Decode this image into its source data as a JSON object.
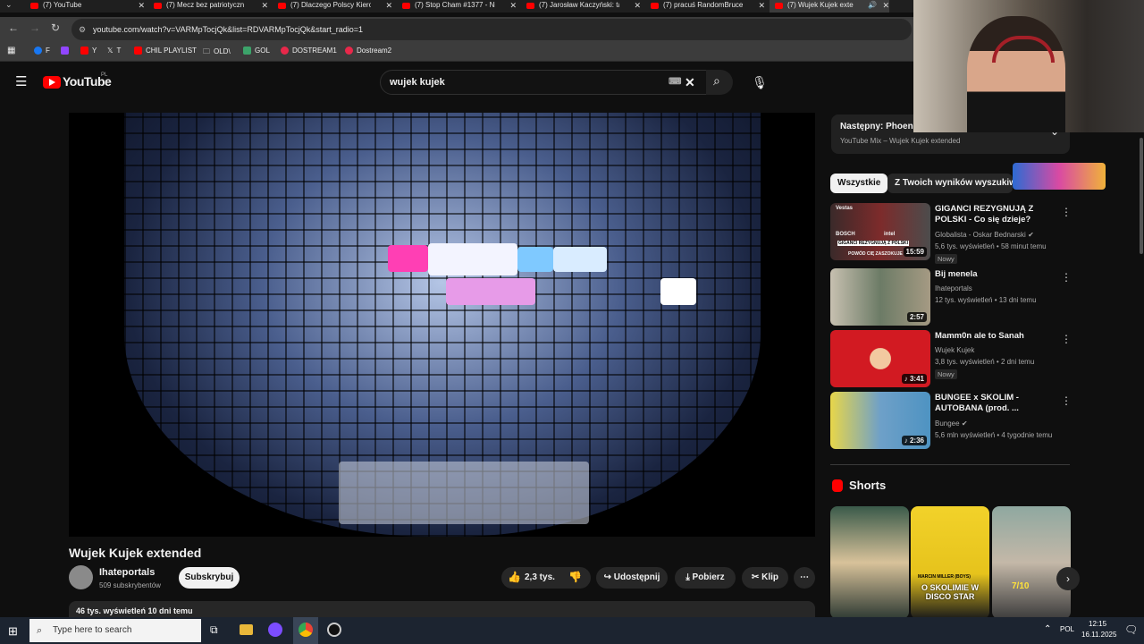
{
  "browser": {
    "tabs": [
      {
        "label": "(7) YouTube"
      },
      {
        "label": "(7) Mecz bez patriotyczn"
      },
      {
        "label": "(7) Dlaczego Polscy Kiero"
      },
      {
        "label": "(7) Stop Cham #1377 - Ni"
      },
      {
        "label": "(7) Jarosław Kaczyński: ta"
      },
      {
        "label": "(7) pracuś RandomBruce"
      },
      {
        "label": "(7) Wujek Kujek exte"
      }
    ],
    "url": "youtube.com/watch?v=VARMpTocjQk&list=RDVARMpTocjQk&start_radio=1",
    "bookmarks": [
      {
        "label": "F",
        "color": "#1877f2"
      },
      {
        "label": "",
        "color": "#9146ff"
      },
      {
        "label": "Y",
        "color": "#ff0000"
      },
      {
        "label": "T",
        "color": "#e0e0e0"
      },
      {
        "label": "CHIL PLAYLIST",
        "color": "#ff0000"
      },
      {
        "label": "OLD\\",
        "color": "#bbbbbb"
      },
      {
        "label": "GOL",
        "color": "#3ca36a"
      },
      {
        "label": "DOSTREAM1",
        "color": "#e8284a"
      },
      {
        "label": "Dostream2",
        "color": "#e8284a"
      }
    ]
  },
  "youtube": {
    "logo_text": "YouTube",
    "logo_country": "PL",
    "search_value": "wujek kujek",
    "video": {
      "title": "Wujek Kujek extended",
      "channel": "Ihateportals",
      "subscribers": "509 subskrybentów",
      "subscribe_label": "Subskrybuj",
      "likes": "2,3 tys.",
      "share_label": "Udostępnij",
      "download_label": "Pobierz",
      "clip_label": "Klip",
      "views_date": "46 tys. wyświetleń  10 dni temu"
    },
    "next": {
      "title": "Następny: Phoenix",
      "subtitle": "YouTube Mix – Wujek Kujek extended"
    },
    "chips": [
      "Wszystkie",
      "Z Twoich wyników wyszukiwan"
    ],
    "recommended": [
      {
        "title": "GIGANCI REZYGNUJĄ Z POLSKI - Co się dzieje?",
        "channel": "Globalista - Oskar Bednarski",
        "verified": "✔",
        "meta": "5,6 tys. wyświetleń • 58 minut temu",
        "badge": "Nowy",
        "duration": "15:59",
        "thumb_text": "GIGANCI REZYGNUJĄ Z POLSKI",
        "thumb_sub": "POWÓD CIĘ ZASZOKUJE",
        "thumb_brand1": "BOSCH",
        "thumb_brand2": "intel",
        "thumb_brand3": "Vestas"
      },
      {
        "title": "Bij menela",
        "channel": "Ihateportals",
        "verified": "",
        "meta": "12 tys. wyświetleń • 13 dni temu",
        "badge": "",
        "duration": "2:57"
      },
      {
        "title": "Mamm0n ale to Sanah",
        "channel": "Wujek Kujek",
        "verified": "",
        "meta": "3,8 tys. wyświetleń • 2 dni temu",
        "badge": "Nowy",
        "duration": "3:41"
      },
      {
        "title": "BUNGEE x SKOLIM - AUTOBANA (prod. ...",
        "channel": "Bungee",
        "verified": "✔",
        "meta": "5,6 mln wyświetleń • 4 tygodnie temu",
        "badge": "",
        "duration": "2:36"
      }
    ],
    "shorts_label": "Shorts",
    "shorts": [
      {
        "text": ""
      },
      {
        "text": "O SKOLIMIE W DISCO STAR",
        "top": "MARCIN MILLER (BOYS)"
      },
      {
        "text": "7/10"
      }
    ]
  },
  "taskbar": {
    "search_placeholder": "Type here to search",
    "lang": "POL",
    "time": "12:15",
    "date": "16.11.2025"
  },
  "colors": {
    "youtube_red": "#ff0000",
    "background": "#0f0f0f"
  }
}
